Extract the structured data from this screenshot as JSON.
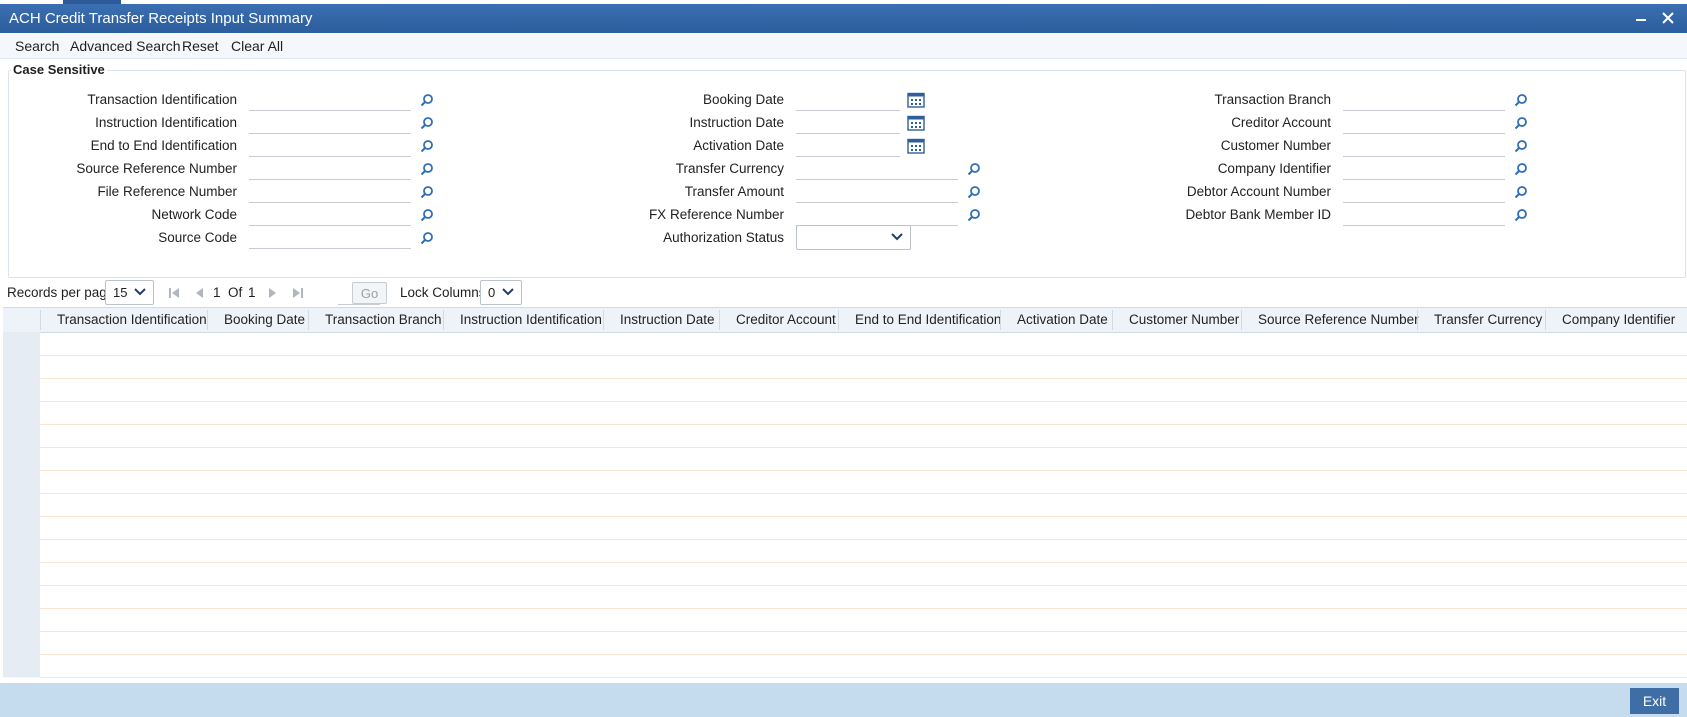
{
  "window": {
    "title": "ACH Credit Transfer Receipts Input Summary"
  },
  "toolbar": {
    "search": "Search",
    "advanced_search": "Advanced Search",
    "reset": "Reset",
    "clear_all": "Clear All"
  },
  "criteria": {
    "legend": "Case Sensitive",
    "col1": [
      "Transaction Identification",
      "Instruction Identification",
      "End to End Identification",
      "Source Reference Number",
      "File Reference Number",
      "Network Code",
      "Source Code"
    ],
    "col2": [
      "Booking Date",
      "Instruction Date",
      "Activation Date",
      "Transfer Currency",
      "Transfer Amount",
      "FX Reference Number",
      "Authorization Status"
    ],
    "col3": [
      "Transaction Branch",
      "Creditor Account",
      "Customer Number",
      "Company Identifier",
      "Debtor Account Number",
      "Debtor Bank Member ID"
    ],
    "authorization_status_value": ""
  },
  "pager": {
    "records_per_page_label": "Records per page",
    "records_per_page_value": "15",
    "current_page": "1",
    "of_label": "Of",
    "total_pages": "1",
    "go_label": "Go",
    "lock_columns_label": "Lock Columns",
    "lock_columns_value": "0"
  },
  "grid": {
    "columns": [
      "Transaction Identification",
      "Booking Date",
      "Transaction Branch",
      "Instruction Identification",
      "Instruction Date",
      "Creditor Account",
      "End to End Identification",
      "Activation Date",
      "Customer Number",
      "Source Reference Number",
      "Transfer Currency",
      "Company Identifier"
    ]
  },
  "footer": {
    "exit_label": "Exit"
  },
  "colors": {
    "titlebar": "#2c5d9d",
    "footer": "#c5dcef",
    "exit_button": "#3f6ea6",
    "lookup_icon": "#2f6fb3"
  }
}
